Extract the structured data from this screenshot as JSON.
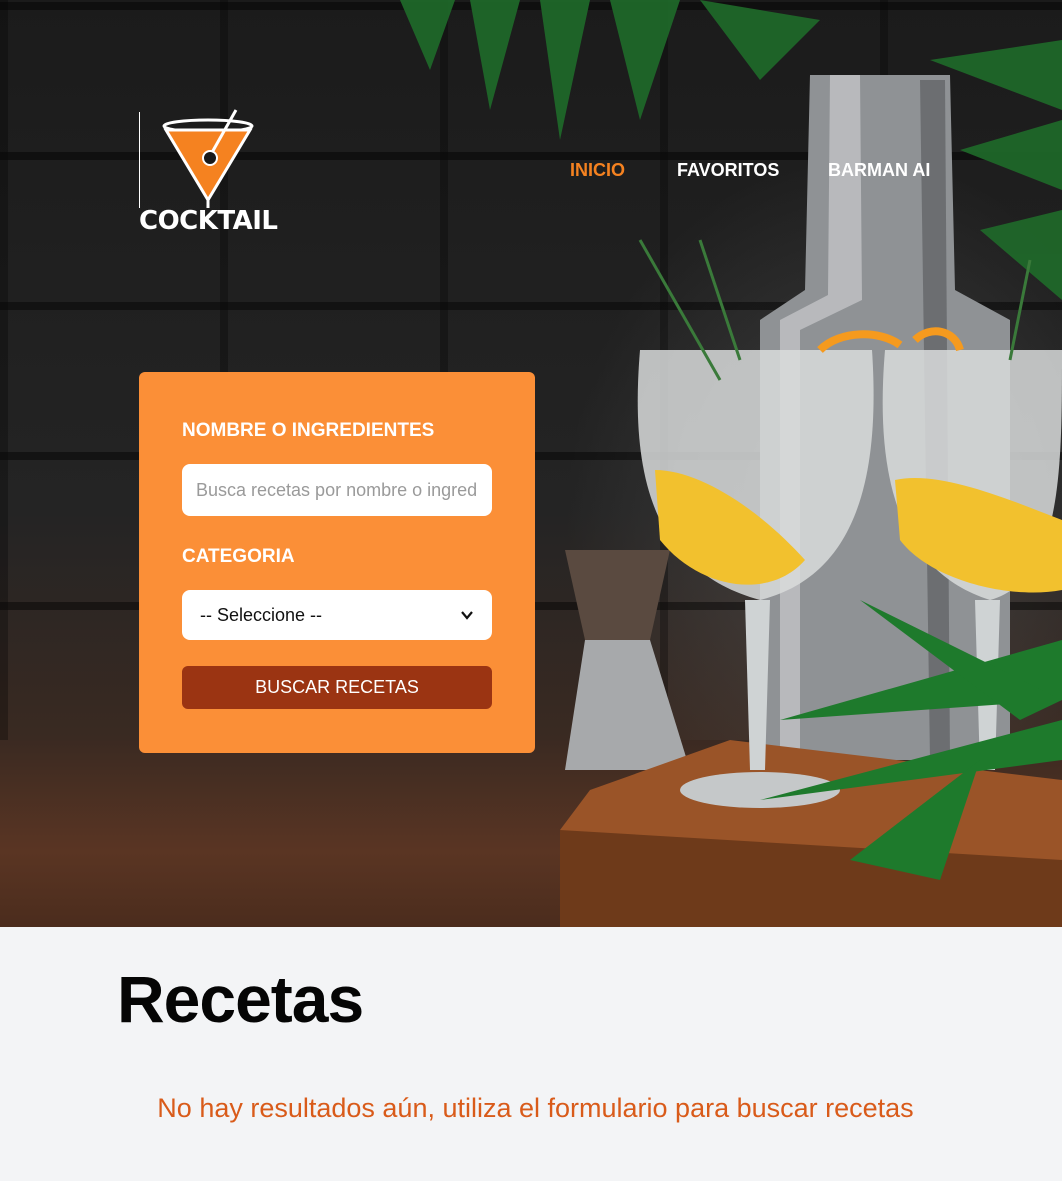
{
  "brand": {
    "name": "COCKTAIL",
    "accent": "#f58220"
  },
  "nav": {
    "items": [
      {
        "label": "INICIO",
        "active": true
      },
      {
        "label": "FAVORITOS",
        "active": false
      },
      {
        "label": "BARMAN AI",
        "active": false
      }
    ]
  },
  "search_form": {
    "name_label": "NOMBRE O INGREDIENTES",
    "name_placeholder": "Busca recetas por nombre o ingredientes",
    "name_value": "",
    "category_label": "CATEGORIA",
    "category_selected": "-- Seleccione --",
    "submit_label": "BUSCAR RECETAS",
    "card_color": "#fb8f37",
    "button_color": "#9b3412"
  },
  "results": {
    "heading": "Recetas",
    "empty_message": "No hay resultados aún, utiliza el formulario para buscar recetas",
    "message_color": "#d95b1a"
  }
}
